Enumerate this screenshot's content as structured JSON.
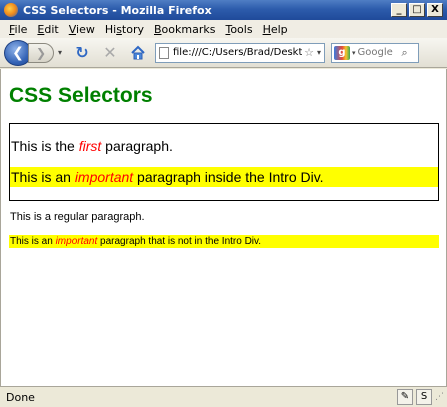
{
  "window": {
    "title": "CSS Selectors - Mozilla Firefox",
    "minimize_glyph": "_",
    "maximize_glyph": "□",
    "close_glyph": "X"
  },
  "menu": {
    "items": [
      {
        "acc": "F",
        "rest": "ile"
      },
      {
        "acc": "E",
        "rest": "dit"
      },
      {
        "acc": "V",
        "rest": "iew"
      },
      {
        "pre": "Hi",
        "acc": "s",
        "rest": "tory"
      },
      {
        "acc": "B",
        "rest": "ookmarks"
      },
      {
        "acc": "T",
        "rest": "ools"
      },
      {
        "acc": "H",
        "rest": "elp"
      }
    ]
  },
  "nav": {
    "back_glyph": "❮",
    "forward_glyph": "❯",
    "dropdown_glyph": "▾",
    "reload_glyph": "↻",
    "stop_glyph": "✕",
    "url": "file:///C:/Users/Brad/Desktop/C",
    "star_glyph": "☆",
    "url_dropdown_glyph": "▾",
    "search_engine_glyph": "g",
    "search_placeholder": "Google",
    "search_glyph": "⌕"
  },
  "page": {
    "heading": "CSS Selectors",
    "intro_first": {
      "before": "This is the ",
      "em": "first",
      "after": " paragraph."
    },
    "intro_important": {
      "before": "This is an ",
      "em": "important",
      "after": " paragraph inside the Intro Div."
    },
    "regular": "This is a regular paragraph.",
    "regular_important": {
      "before": "This is an ",
      "em": "important",
      "after": " paragraph that is not in the Intro Div."
    }
  },
  "status": {
    "text": "Done",
    "addon_glyph": "✎",
    "s_glyph": "S",
    "grip_glyph": "⋰"
  },
  "colors": {
    "heading": "#008000",
    "emphasis": "#ff0000",
    "highlight": "#ffff00"
  }
}
